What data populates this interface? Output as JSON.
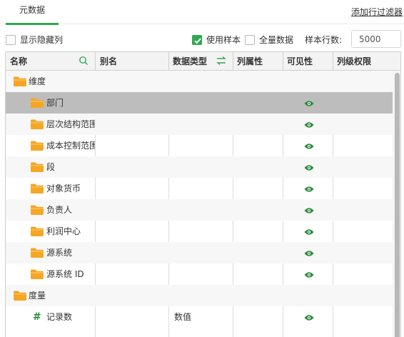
{
  "tabs": {
    "active_label": "元数据"
  },
  "links": {
    "add_filter": "添加行过滤器"
  },
  "toolbar": {
    "show_hidden_label": "显示隐藏列",
    "show_hidden_checked": false,
    "use_sample_label": "使用样本",
    "use_sample_checked": true,
    "full_data_label": "全量数据",
    "full_data_checked": false,
    "sample_rows_label": "样本行数:",
    "sample_rows_value": "5000"
  },
  "grid": {
    "columns": [
      "名称",
      "别名",
      "数据类型",
      "列属性",
      "可见性",
      "列级权限"
    ],
    "rows": [
      {
        "name": "维度",
        "type": "folder",
        "level": 0,
        "visible": false,
        "dtype": ""
      },
      {
        "name": "部门",
        "type": "folder",
        "level": 1,
        "visible": true,
        "dtype": "",
        "selected": true
      },
      {
        "name": "层次结构范围",
        "type": "folder",
        "level": 1,
        "visible": true,
        "dtype": ""
      },
      {
        "name": "成本控制范围",
        "type": "folder",
        "level": 1,
        "visible": true,
        "dtype": ""
      },
      {
        "name": "段",
        "type": "folder",
        "level": 1,
        "visible": true,
        "dtype": ""
      },
      {
        "name": "对象货币",
        "type": "folder",
        "level": 1,
        "visible": true,
        "dtype": ""
      },
      {
        "name": "负责人",
        "type": "folder",
        "level": 1,
        "visible": true,
        "dtype": ""
      },
      {
        "name": "利润中心",
        "type": "folder",
        "level": 1,
        "visible": true,
        "dtype": ""
      },
      {
        "name": "源系统",
        "type": "folder",
        "level": 1,
        "visible": true,
        "dtype": ""
      },
      {
        "name": "源系统 ID",
        "type": "folder",
        "level": 1,
        "visible": true,
        "dtype": ""
      },
      {
        "name": "度量",
        "type": "folder",
        "level": 0,
        "visible": false,
        "dtype": ""
      },
      {
        "name": "记录数",
        "type": "measure",
        "level": 1,
        "visible": true,
        "dtype": "数值"
      }
    ]
  },
  "colors": {
    "accent": "#2fa84f",
    "folder": "#f5a623",
    "eye": "#2e8b3e",
    "selected_row": "#bdbdbd"
  },
  "icons": {
    "search": "search-icon",
    "swap": "swap-icon",
    "folder": "folder-icon",
    "eye": "eye-icon",
    "hash": "hash-icon"
  }
}
